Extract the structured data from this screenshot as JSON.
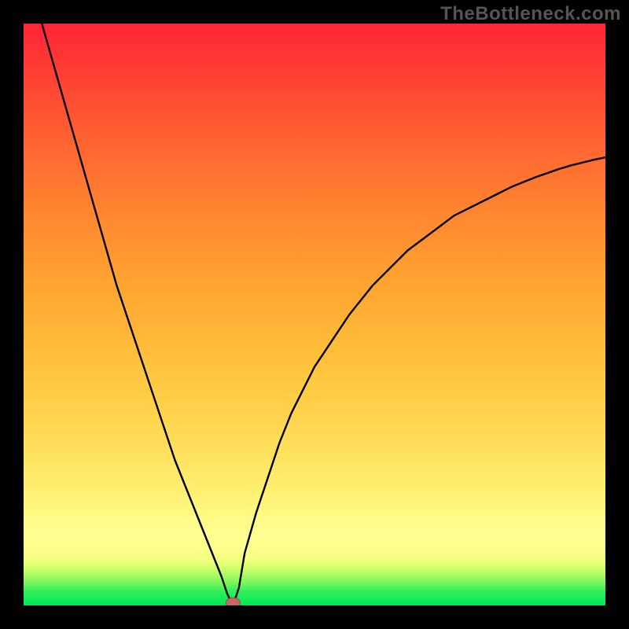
{
  "source_label": "TheBottleneck.com",
  "colors": {
    "frame": "#000000",
    "curve": "#000000",
    "marker_fill": "#cc6666",
    "marker_stroke": "#a04a4a",
    "gradient_top": "#ff2436",
    "gradient_mid": "#ffc53e",
    "gradient_bottom": "#00e756"
  },
  "chart_data": {
    "type": "line",
    "title": "",
    "xlabel": "",
    "ylabel": "",
    "xlim": [
      0,
      100
    ],
    "ylim": [
      0,
      100
    ],
    "x": [
      0,
      2,
      4,
      6,
      8,
      10,
      12,
      14,
      16,
      18,
      20,
      22,
      24,
      26,
      28,
      30,
      32,
      34,
      35,
      36,
      37,
      38,
      40,
      42,
      44,
      46,
      48,
      50,
      52,
      54,
      56,
      58,
      60,
      62,
      64,
      66,
      68,
      70,
      72,
      74,
      76,
      78,
      80,
      82,
      84,
      86,
      88,
      90,
      92,
      94,
      96,
      98,
      100
    ],
    "values": [
      130,
      104,
      97,
      90,
      83,
      76,
      69,
      62,
      55,
      49,
      43,
      37,
      31,
      25,
      20,
      15,
      10,
      5,
      2,
      0,
      3,
      9,
      16,
      22,
      28,
      33,
      37,
      41,
      44,
      47,
      50,
      52.5,
      55,
      57,
      59,
      61,
      62.5,
      64,
      65.5,
      67,
      68,
      69,
      70,
      71,
      72,
      72.8,
      73.6,
      74.3,
      75,
      75.6,
      76.1,
      76.6,
      77
    ],
    "marker": {
      "x": 36,
      "y": 0.5
    },
    "note": "Bottleneck curve: left branch descends steeply to a minimum near x≈36 (green zone), right branch rises with diminishing slope. Background gradient implies green = low bottleneck, red = high bottleneck. Axes unlabeled."
  }
}
